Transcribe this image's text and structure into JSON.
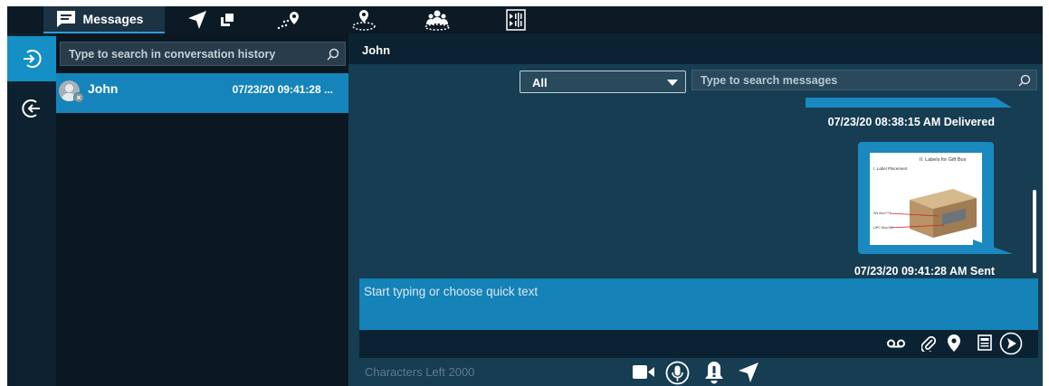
{
  "top_tabs": {
    "messages_label": "Messages",
    "icons": [
      "messages-icon",
      "location-arrow-icon",
      "expand-icon",
      "route-icon",
      "geofence-icon",
      "group-icon",
      "media-list-icon"
    ]
  },
  "rail": {
    "items": [
      "sign-in-icon",
      "sign-out-icon"
    ]
  },
  "conversations": {
    "search_placeholder": "Type to search in conversation history",
    "items": [
      {
        "name": "John",
        "time": "07/23/20 09:41:28 ..."
      }
    ]
  },
  "chat": {
    "title": "John",
    "filter_value": "All",
    "search_placeholder": "Type to search messages",
    "messages": [
      {
        "status": "07/23/20 08:38:15 AM Delivered"
      },
      {
        "status": "07/23/20 09:41:28 AM Sent",
        "image": {
          "heading": "II. Labels for Gift Box",
          "subheading": "I. Label Placement",
          "label_a": "SN Box???",
          "label_b": "UPC Box???"
        }
      }
    ],
    "composer_placeholder": "Start typing or choose quick text",
    "characters_left": "Characters Left 2000",
    "toolbar_icons": [
      "voicemail-icon",
      "paperclip-icon",
      "map-pin-icon",
      "document-icon",
      "send-icon"
    ],
    "media_icons": [
      "video-call-icon",
      "microphone-icon",
      "alert-bell-icon",
      "location-arrow-icon"
    ]
  },
  "colors": {
    "accent": "#1584bb",
    "dark_bg": "#0b1822",
    "chat_bg": "#163d52"
  }
}
